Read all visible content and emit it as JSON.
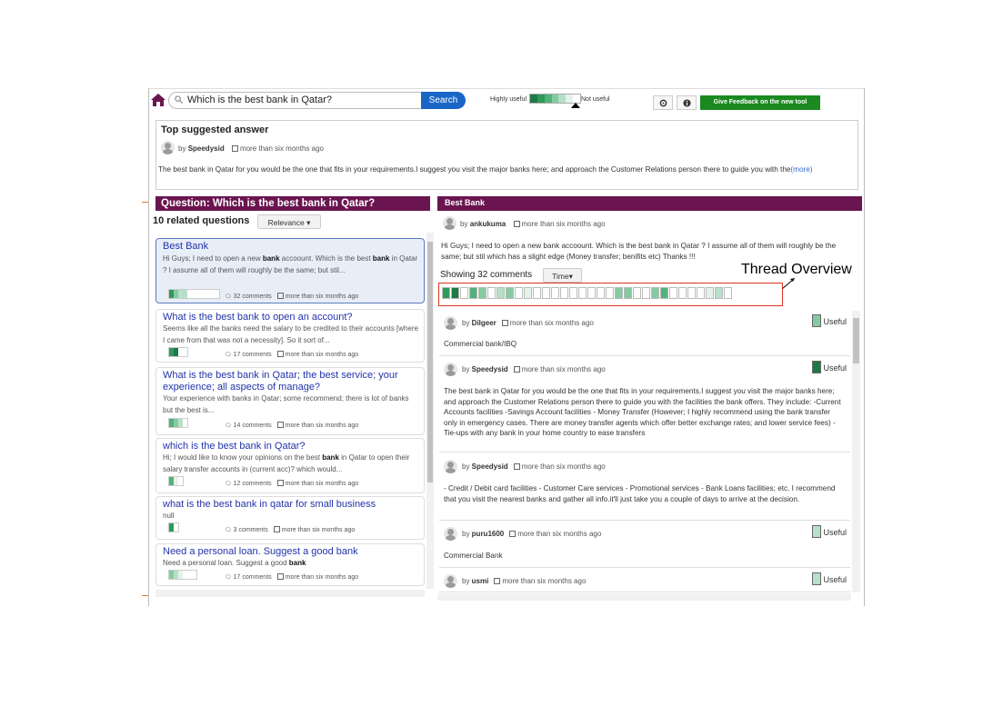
{
  "search": {
    "query": "Which is the best bank in Qatar?",
    "button": "Search"
  },
  "legend": {
    "high": "Highly useful",
    "low": "Not useful",
    "colors": [
      "#1e7a45",
      "#2e9a5a",
      "#52b27c",
      "#85cba2",
      "#b6e0c8",
      "#e4f3ea",
      "#ffffff"
    ]
  },
  "toolbar": {
    "refresh_icon": "refresh-icon",
    "info_icon": "info-icon",
    "feedback": "Give Feedback on the new tool"
  },
  "top_answer": {
    "heading": "Top suggested answer",
    "by": "by",
    "author": "Speedysid",
    "time": "more than six months ago",
    "text": "The best bank in Qatar for you would be the one that fits in your requirements.I suggest you visit the major banks here; and approach the Customer Relations person there to guide you with the",
    "more": "(more)"
  },
  "left": {
    "question_bar": "Question: Which is the best bank in Qatar?",
    "related_count": "10 related questions",
    "sort": "Relevance ▾",
    "items": [
      {
        "title": "Best Bank",
        "snippet_a": "Hi Guys; I need to open a new ",
        "snippet_b": "bank",
        "snippet_c": " accoount. Which is the best ",
        "snippet_d": "bank",
        "snippet_e": " in Qatar ? I assume all of them will roughly be the same; but stil...",
        "comments": "32 comments",
        "time": "more than six months ago"
      },
      {
        "title": "What is the best bank to open an account?",
        "snippet": "Seems like all the banks need the salary to be credited to their accounts [where I came from that was not a necessity]. So it sort of...",
        "comments": "17 comments",
        "time": "more than six months ago"
      },
      {
        "title": "What is the best bank in Qatar; the best service; your experience; all aspects of manage?",
        "snippet": "Your experience with banks in Qatar; some recommend; there is lot of banks but the best is...",
        "comments": "14 comments",
        "time": "more than six months ago"
      },
      {
        "title": "which is the best bank in Qatar?",
        "snippet_a": "Hi; I would like to know your opinions on the best ",
        "snippet_b": "bank",
        "snippet_c": " in Qatar to open their salary transfer accounts in (current acc)? which would...",
        "comments": "12 comments",
        "time": "more than six months ago"
      },
      {
        "title": "what is the best bank in qatar for small business",
        "snippet": "null",
        "comments": "3 comments",
        "time": "more than six months ago"
      },
      {
        "title": "Need a personal loan. Suggest a good bank",
        "snippet_a": "Need a personal loan. Suggest a good ",
        "snippet_b": "bank",
        "comments": "17 comments",
        "time": "more than six months ago"
      }
    ]
  },
  "right": {
    "bar": "Best Bank",
    "by": "by",
    "author": "ankukuma",
    "time": "more than six months ago",
    "body": "Hi Guys; I need to open a new bank accoount. Which is the best bank in Qatar ? I assume all of them will roughly be the same; but stil which has a slight edge (Money transfer; benifits etc) Thanks !!!",
    "showing": "Showing 32 comments",
    "sort": "Time▾",
    "thread_label": "Thread Overview",
    "comments": [
      {
        "author": "Dilgeer",
        "time": "more than six months ago",
        "useful": "Useful",
        "text": "Commercial bank/IBQ"
      },
      {
        "author": "Speedysid",
        "time": "more than six months ago",
        "useful": "Useful",
        "text": "The best bank in Qatar for you would be the one that fits in your requirements.I suggest you visit the major banks here; and approach the Customer Relations person there to guide you with the facilities the bank offers. They include: -Current Accounts facilities -Savings Account facilities - Money Transfer (However; I highly recommend using the bank transfer only in emergency cases. There are money transfer agents which offer better exchange rates; and lower service fees) - Tie-ups with any bank in your home country to ease transfers"
      },
      {
        "author": "Speedysid",
        "time": "more than six months ago",
        "useful": "",
        "text": "- Credit / Debit card facilities - Customer Care services - Promotional services - Bank Loans facilities; etc. I recommend that you visit the nearest banks and gather all info.it'll just take you a couple of days to arrive at the decision."
      },
      {
        "author": "puru1600",
        "time": "more than six months ago",
        "useful": "Useful",
        "text": "Commercial Bank"
      },
      {
        "author": "usmi",
        "time": "more than six months ago",
        "useful": "Useful",
        "text": ""
      }
    ]
  }
}
